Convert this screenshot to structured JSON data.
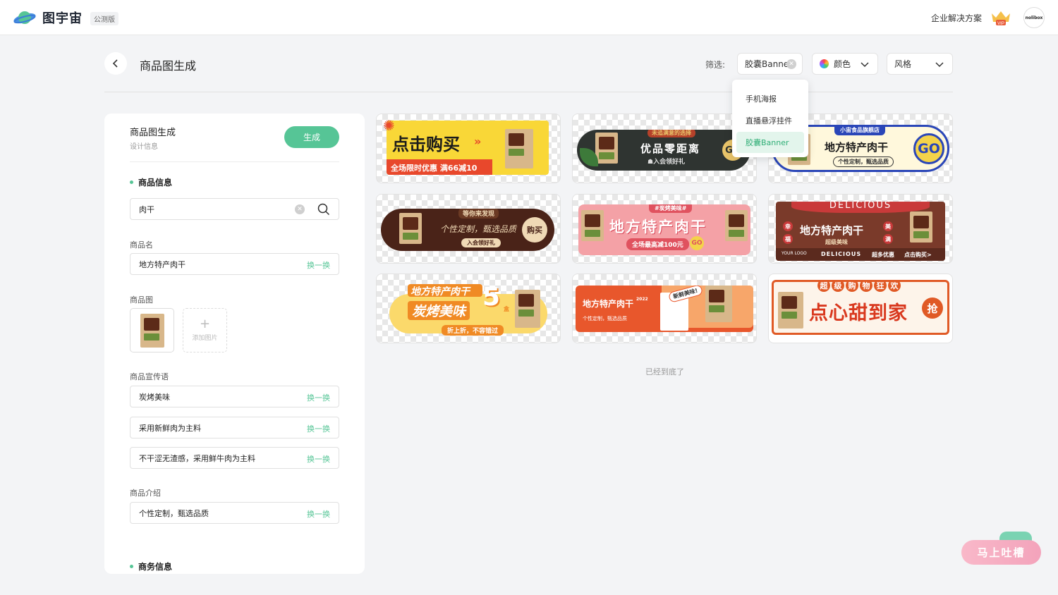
{
  "header": {
    "brand": "图宇宙",
    "beta_badge": "公测版",
    "enterprise_link": "企业解决方案",
    "vip_badge": "VIP",
    "avatar_text": "nolibox"
  },
  "toolbar": {
    "title": "商品图生成",
    "filter_label": "筛选:",
    "type_filter": "胶囊Banner",
    "color_filter": "颜色",
    "style_filter": "风格"
  },
  "dropdown": {
    "items": [
      "手机海报",
      "直播悬浮挂件",
      "胶囊Banner"
    ],
    "selected": "胶囊Banner"
  },
  "panel": {
    "title": "商品图生成",
    "subtitle": "设计信息",
    "generate_label": "生成",
    "product_info_heading": "商品信息",
    "search_value": "肉干",
    "name_label": "商品名",
    "name_value": "地方特产肉干",
    "swap_label": "换一换",
    "image_label": "商品图",
    "add_image_label": "添加图片",
    "slogan_label": "商品宣传语",
    "slogans": [
      "炭烤美味",
      "采用新鲜肉为主料",
      "不干涩无渣感，采用鲜牛肉为主料"
    ],
    "intro_label": "商品介绍",
    "intro_value": "个性定制，甄选品质",
    "business_heading": "商务信息"
  },
  "gallery": {
    "b1": {
      "main": "点击购买",
      "sub": "全场限时优惠 满66减10"
    },
    "b2": {
      "top": "未追满意的选择",
      "main": "优品零距离",
      "sub": "☗入会领好礼",
      "go": "GO"
    },
    "b3": {
      "tag": "小宙食品旗舰店",
      "main": "地方特产肉干",
      "sub": "个性定制，甄选品质",
      "go": "GO"
    },
    "b4": {
      "top": "等你来发现",
      "main": "个性定制，甄选品质",
      "sub": "入会领好礼",
      "cta": "购买"
    },
    "b5": {
      "tag": "#炭烤美味#",
      "main": "地方特产肉干",
      "sub": "全场最高减100元",
      "go": "GO"
    },
    "b6": {
      "ribbon": "DELICIOUS",
      "main": "地方特产肉干",
      "sub": "超级美味",
      "left1": "幸",
      "left2": "福",
      "right1": "美",
      "right2": "满",
      "foot1": "DELICIOUS",
      "foot2": "超多优惠",
      "foot3": "点击购买>",
      "logo": "YOUR LOGO"
    },
    "b7": {
      "main1": "地方特产肉干",
      "main2": "炭烤美味",
      "num": "5",
      "unit": "盒",
      "sub": "折上折，不容错过"
    },
    "b8": {
      "main": "地方特产肉干",
      "year": "2022",
      "sub": "个性定制，甄选品质",
      "badge": "新鲜美味!"
    },
    "b9": {
      "top": [
        "超",
        "级",
        "购",
        "物",
        "狂",
        "欢"
      ],
      "main": "点心甜到家",
      "cta": "抢"
    }
  },
  "bottom_note": "已经到底了",
  "feedback_label": "马上吐槽",
  "colors": {
    "accent": "#56c596",
    "accent_light": "#e3f5ec",
    "feedback": "#f3a3bb"
  }
}
